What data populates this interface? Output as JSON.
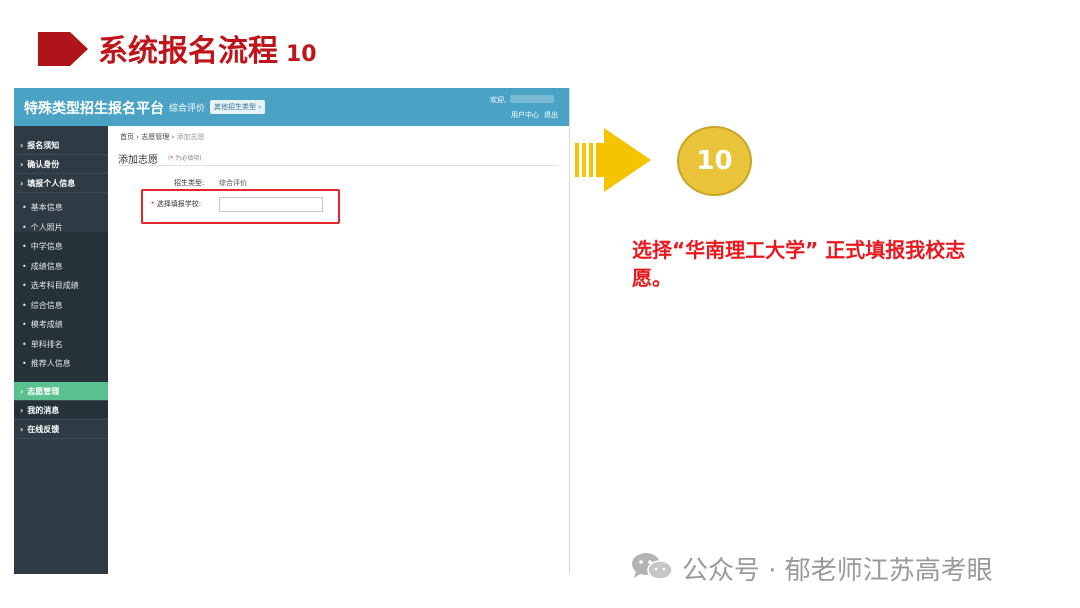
{
  "slide": {
    "title": "系统报名流程",
    "step": "10"
  },
  "app": {
    "platform_name": "特殊类型招生报名平台",
    "mode": "综合评价",
    "other_type_button": "其他招生类型 ›",
    "welcome": "欢迎,",
    "user_center": "用户中心",
    "logout": "退出"
  },
  "sidebar": {
    "groups_top": [
      "报名须知",
      "确认身份",
      "填报个人信息"
    ],
    "subitems": [
      "基本信息",
      "个人照片",
      "中学信息",
      "成绩信息",
      "选考科目成绩",
      "综合信息",
      "模考成绩",
      "单科排名",
      "推荐人信息"
    ],
    "groups_bottom": [
      "志愿管理",
      "我的消息",
      "在线反馈"
    ],
    "active": "志愿管理"
  },
  "main": {
    "breadcrumb": [
      "首页",
      "志愿管理",
      "添加志愿"
    ],
    "page_title": "添加志愿",
    "required_note": "为必填项",
    "enroll_type_label": "招生类型:",
    "enroll_type_value": "综合评价",
    "school_label": "选择填报学校:",
    "school_value": ""
  },
  "callout": {
    "step": "10",
    "text": "选择“华南理工大学” 正式填报我校志愿。"
  },
  "watermark": "公众号 · 郁老师江苏高考眼",
  "colors": {
    "title_red": "#c0141b",
    "topbar_blue": "#4aa3c4",
    "sidebar_dark": "#2f3b44",
    "active_green": "#59c18d",
    "highlight_red": "#e3262c",
    "arrow_yellow": "#f5c400",
    "circle_gold": "#e9c43a",
    "text_red": "#e8191e"
  },
  "icons": {
    "title_arrow": "pentagon-arrow-icon",
    "callout_arrow": "striped-arrow-icon",
    "watermark": "wechat-icon",
    "sidebar_group": "chevron-right-icon",
    "sidebar_sub": "bullet-dot-icon"
  }
}
